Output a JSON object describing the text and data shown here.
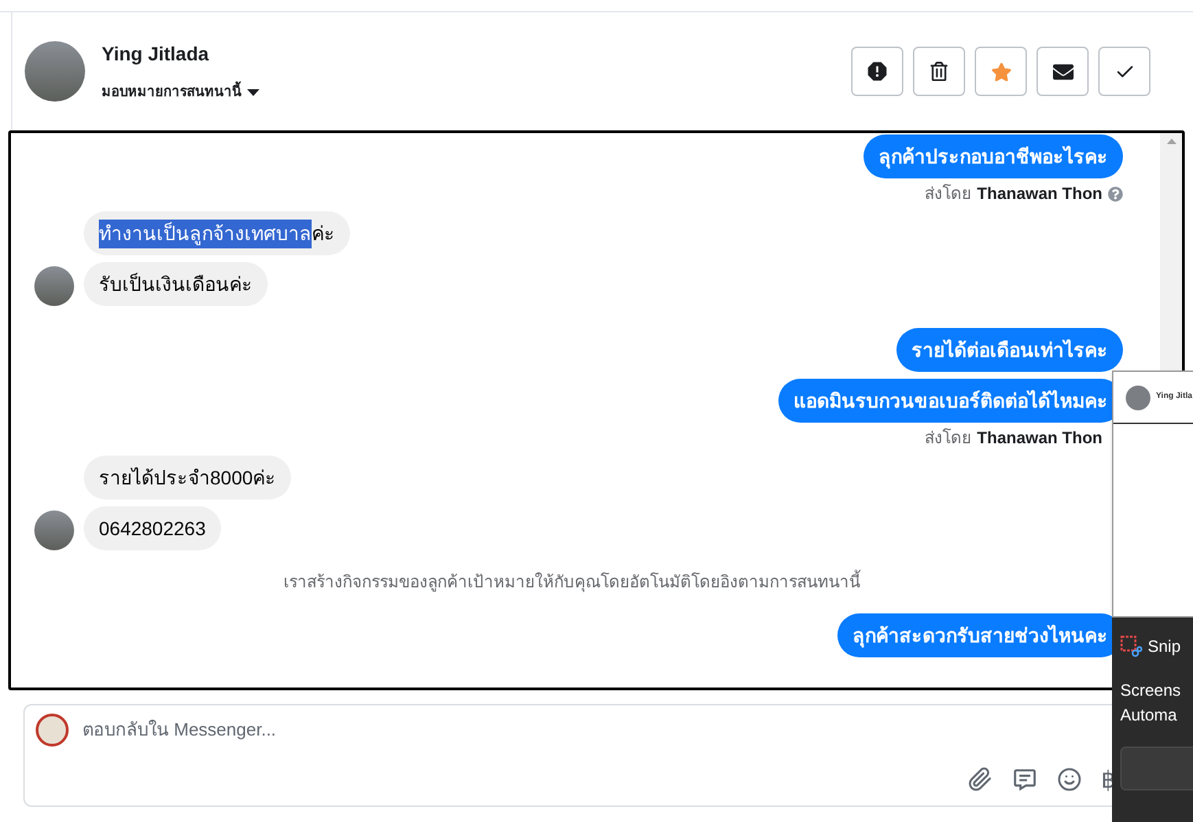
{
  "contact": {
    "name": "Ying Jitlada",
    "assign_label": "มอบหมายการสนทนานี้"
  },
  "messages": [
    {
      "kind": "outgoing",
      "text": "ลุกค้าประกอบอาชีพอะไรคะ"
    },
    {
      "kind": "sender",
      "prefix": "ส่งโดย",
      "name": "Thanawan Thon",
      "help": true
    },
    {
      "kind": "incoming",
      "highlighted": "ทำงานเป็นลูกจ้างเทศบาล",
      "text": "ค่ะ",
      "avatar": false
    },
    {
      "kind": "incoming",
      "text": "รับเป็นเงินเดือนค่ะ",
      "avatar": true
    },
    {
      "kind": "outgoing",
      "text": "รายได้ต่อเดือนเท่าไรคะ"
    },
    {
      "kind": "outgoing",
      "text": "แอดมินรบกวนขอเบอร์ติดต่อได้ไหมคะ"
    },
    {
      "kind": "sender",
      "prefix": "ส่งโดย",
      "name": "Thanawan Thon",
      "help": false
    },
    {
      "kind": "incoming",
      "text": "รายได้ประจำ8000ค่ะ",
      "avatar": false
    },
    {
      "kind": "incoming",
      "text": "0642802263",
      "avatar": true
    },
    {
      "kind": "notice",
      "text": "เราสร้างกิจกรรมของลูกค้าเป้าหมายให้กับคุณโดยอัตโนมัติโดยอิงตามการสนทนานี้"
    },
    {
      "kind": "outgoing",
      "text": "ลุกค้าสะดวกรับสายช่วงไหนคะ"
    }
  ],
  "composer": {
    "placeholder": "ตอบกลับใน Messenger...",
    "currency_symbol": "฿"
  },
  "snip_preview": {
    "title": "Ying Jitla"
  },
  "snip_toast": {
    "app": "Snip",
    "line_1": "Screens",
    "line_2": "Automa"
  }
}
